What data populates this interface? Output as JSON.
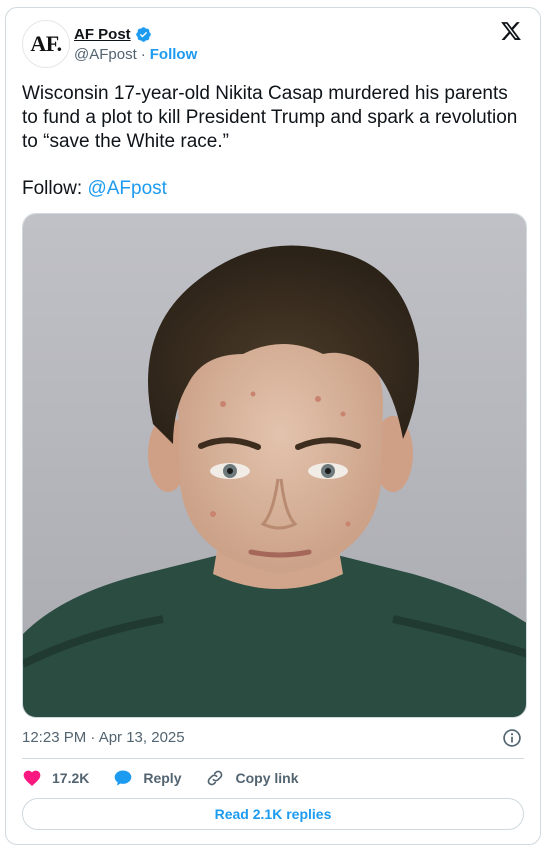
{
  "author": {
    "avatar_text": "AF.",
    "display_name": "AF Post",
    "handle": "@AFpost",
    "separator": "·",
    "follow_label": "Follow"
  },
  "tweet": {
    "text": "Wisconsin 17-year-old Nikita Casap murdered his parents to fund a plot to kill President Trump and spark a revolution to “save the White race.”",
    "follow_prefix": "Follow: ",
    "mention": "@AFpost",
    "image_alt": "Mugshot of a young man with brown hair wearing a dark green garment",
    "timestamp": "12:23 PM · Apr 13, 2025"
  },
  "actions": {
    "like_count": "17.2K",
    "reply_label": "Reply",
    "copy_label": "Copy link"
  },
  "read_replies_label": "Read 2.1K replies",
  "colors": {
    "accent": "#1d9bf0",
    "like": "#f91880",
    "secondary_text": "#536471",
    "border": "#cfd9de"
  },
  "icons": [
    "verified-badge-icon",
    "x-logo-icon",
    "info-icon",
    "heart-icon",
    "reply-bubble-icon",
    "link-icon"
  ]
}
